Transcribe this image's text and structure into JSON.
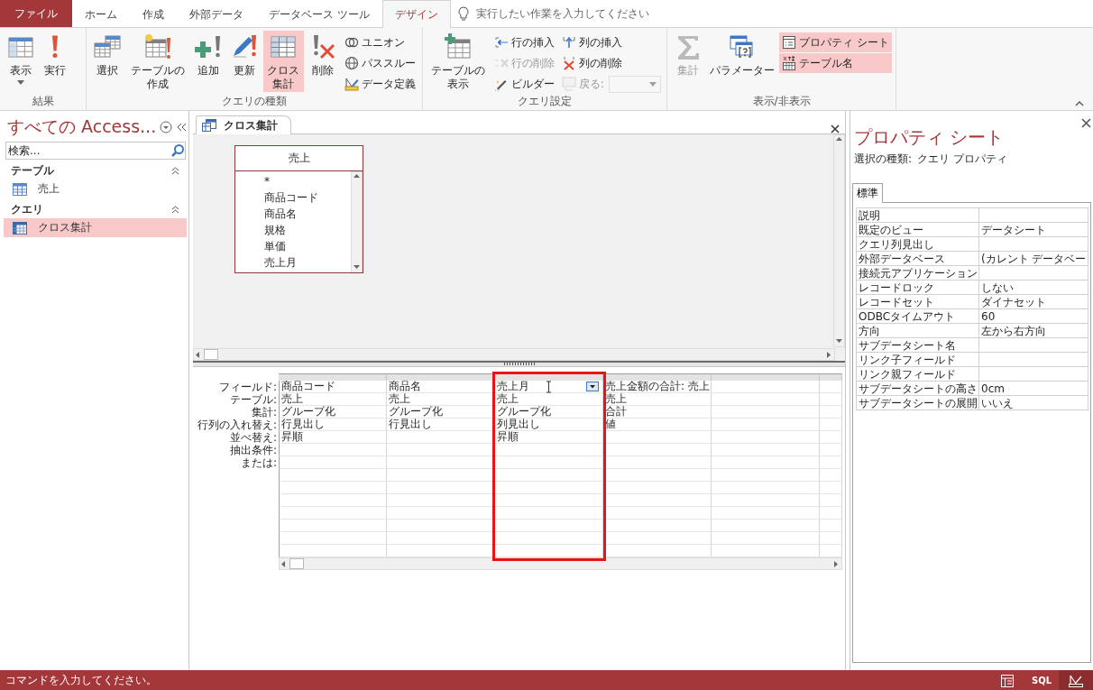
{
  "ribbon_tabs": [
    {
      "label": "ファイル",
      "kind": "file",
      "selected": false
    },
    {
      "label": "ホーム",
      "kind": "tab",
      "selected": false
    },
    {
      "label": "作成",
      "kind": "tab",
      "selected": false
    },
    {
      "label": "外部データ",
      "kind": "tab",
      "selected": false
    },
    {
      "label": "データベース ツール",
      "kind": "tab",
      "selected": false
    },
    {
      "label": "デザイン",
      "kind": "contextual",
      "selected": true
    }
  ],
  "tell_me": {
    "placeholder": "実行したい作業を入力してください"
  },
  "ribbon_groups": [
    {
      "label": "結果",
      "large": [
        {
          "label": "表示",
          "menu": true,
          "selected": false,
          "disabled": false
        },
        {
          "label": "実行",
          "menu": false,
          "selected": false,
          "disabled": false
        }
      ]
    },
    {
      "label": "クエリの種類",
      "large": [
        {
          "label": "選択",
          "menu": false,
          "selected": false,
          "disabled": false
        },
        {
          "label": "テーブルの作成",
          "menu": false,
          "selected": false,
          "disabled": false
        },
        {
          "label": "追加",
          "menu": false,
          "selected": false,
          "disabled": false
        },
        {
          "label": "更新",
          "menu": false,
          "selected": false,
          "disabled": false
        },
        {
          "label": "クロス集計",
          "menu": false,
          "selected": true,
          "disabled": false
        },
        {
          "label": "削除",
          "menu": false,
          "selected": false,
          "disabled": false
        }
      ],
      "small_columns": [
        [
          {
            "kind": "button",
            "label": "ユニオン",
            "selected": false,
            "disabled": false
          },
          {
            "kind": "button",
            "label": "パススルー",
            "selected": false,
            "disabled": false
          },
          {
            "kind": "button",
            "label": "データ定義",
            "selected": false,
            "disabled": false
          }
        ]
      ]
    },
    {
      "label": "クエリ設定",
      "large": [
        {
          "label": "テーブルの表示",
          "menu": false,
          "selected": false,
          "disabled": false
        }
      ],
      "small_columns": [
        [
          {
            "kind": "button",
            "label": "行の挿入",
            "selected": false,
            "disabled": false
          },
          {
            "kind": "button",
            "label": "行の削除",
            "selected": false,
            "disabled": true
          },
          {
            "kind": "button",
            "label": "ビルダー",
            "selected": false,
            "disabled": false
          }
        ],
        [
          {
            "kind": "button",
            "label": "列の挿入",
            "selected": false,
            "disabled": false
          },
          {
            "kind": "button",
            "label": "列の削除",
            "selected": false,
            "disabled": false
          },
          {
            "kind": "combo",
            "label": "戻る:",
            "selected": false,
            "disabled": true
          }
        ]
      ]
    },
    {
      "label": "表示/非表示",
      "large": [
        {
          "label": "集計",
          "menu": false,
          "selected": false,
          "disabled": true
        },
        {
          "label": "パラメーター",
          "menu": false,
          "selected": false,
          "disabled": false
        }
      ],
      "small_columns": [
        [
          {
            "kind": "button",
            "label": "プロパティ シート",
            "selected": true,
            "disabled": false
          },
          {
            "kind": "button",
            "label": "テーブル名",
            "selected": true,
            "disabled": false
          }
        ]
      ]
    }
  ],
  "navigation_pane": {
    "title": "すべての Access...",
    "search": {
      "placeholder": "検索..."
    },
    "groups": [
      {
        "label": "テーブル",
        "expanded": true,
        "items": [
          {
            "label": "売上",
            "kind": "table",
            "selected": false
          }
        ]
      },
      {
        "label": "クエリ",
        "expanded": true,
        "items": [
          {
            "label": "クロス集計",
            "kind": "query",
            "selected": true
          }
        ]
      }
    ]
  },
  "document": {
    "tab": {
      "label": "クロス集計",
      "selected": true
    },
    "table_box": {
      "title": "売上",
      "fields": [
        "*",
        "商品コード",
        "商品名",
        "規格",
        "単価",
        "売上月"
      ]
    },
    "design_grid": {
      "row_labels": [
        "フィールド:",
        "テーブル:",
        "集計:",
        "行列の入れ替え:",
        "並べ替え:",
        "抽出条件:",
        "または:"
      ],
      "columns": [
        {
          "cells": [
            "商品コード",
            "売上",
            "グループ化",
            "行見出し",
            "昇順"
          ],
          "focused": false,
          "highlighted": false
        },
        {
          "cells": [
            "商品名",
            "売上",
            "グループ化",
            "行見出し"
          ],
          "focused": false,
          "highlighted": false
        },
        {
          "cells": [
            "売上月",
            "売上",
            "グループ化",
            "列見出し",
            "昇順"
          ],
          "focused": true,
          "highlighted": true
        },
        {
          "cells": [
            "売上金額の合計: 売上",
            "売上",
            "合計",
            "値"
          ],
          "focused": false,
          "highlighted": false
        }
      ]
    }
  },
  "property_sheet": {
    "title": "プロパティ シート",
    "selection_type_label": "選択の種類:",
    "selection_type": "クエリ プロパティ",
    "tabs": [
      {
        "label": "標準",
        "selected": true
      }
    ],
    "properties": [
      {
        "name": "説明"
      },
      {
        "name": "既定のビュー",
        "value": "データシート"
      },
      {
        "name": "クエリ列見出し"
      },
      {
        "name": "外部データベース",
        "value": "(カレント データベー"
      },
      {
        "name": "接続元アプリケーション"
      },
      {
        "name": "レコードロック",
        "value": "しない"
      },
      {
        "name": "レコードセット",
        "value": "ダイナセット"
      },
      {
        "name": "ODBCタイムアウト",
        "value": "60"
      },
      {
        "name": "方向",
        "value": "左から右方向"
      },
      {
        "name": "サブデータシート名"
      },
      {
        "name": "リンク子フィールド"
      },
      {
        "name": "リンク親フィールド"
      },
      {
        "name": "サブデータシートの高さ",
        "value": "0cm"
      },
      {
        "name": "サブデータシートの展開",
        "value": "いいえ"
      }
    ]
  },
  "status_bar": {
    "message": "コマンドを入力してください。",
    "views": [
      {
        "kind": "datasheet",
        "selected": false
      },
      {
        "kind": "sql",
        "label": "SQL",
        "selected": false
      },
      {
        "kind": "design",
        "selected": true
      }
    ]
  }
}
